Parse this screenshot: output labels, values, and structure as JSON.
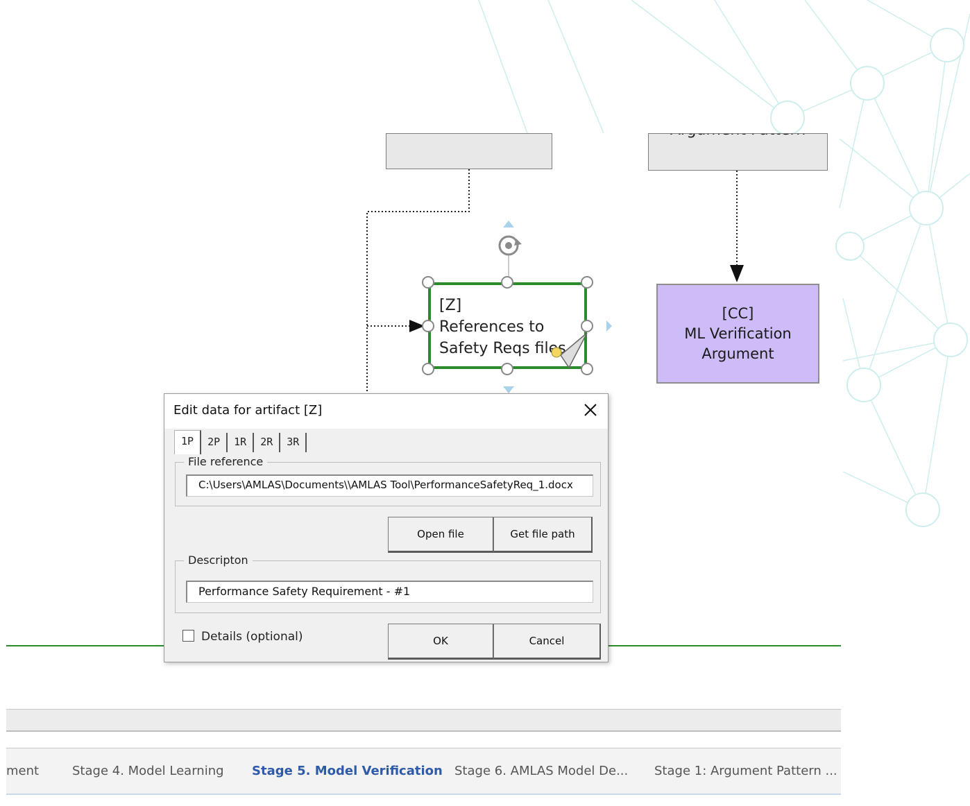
{
  "diagram": {
    "top_right_box_label": "Argument Pattern",
    "artifact_z_label": "[Z]\nReferences to\nSafety Reqs files",
    "artifact_cc_label": "[CC]\nML Verification\nArgument"
  },
  "dialog": {
    "title": "Edit data for artifact [Z]",
    "tabs": [
      "1P",
      "2P",
      "1R",
      "2R",
      "3R"
    ],
    "active_tab": "1P",
    "file_reference_legend": "File reference",
    "file_path_value": "C:\\Users\\AMLAS\\Documents\\\\AMLAS Tool\\PerformanceSafetyReq_1.docx",
    "open_file_label": "Open file",
    "get_file_path_label": "Get file path",
    "description_legend": "Descripton",
    "description_value": "Performance Safety Requirement - #1",
    "details_label": "Details (optional)",
    "details_checked": false,
    "ok_label": "OK",
    "cancel_label": "Cancel"
  },
  "page_tabs": {
    "items": [
      "ment",
      "Stage 4. Model Learning",
      "Stage 5. Model Verification",
      "Stage 6. AMLAS Model De...",
      "Stage 1: Argument Pattern ..."
    ],
    "active": "Stage 5. Model Verification"
  },
  "colors": {
    "selection_green": "#2b8a2b",
    "cc_fill": "#cdbcf7",
    "active_tab_blue": "#2e5aa8",
    "network_teal": "#bfe6e4"
  }
}
